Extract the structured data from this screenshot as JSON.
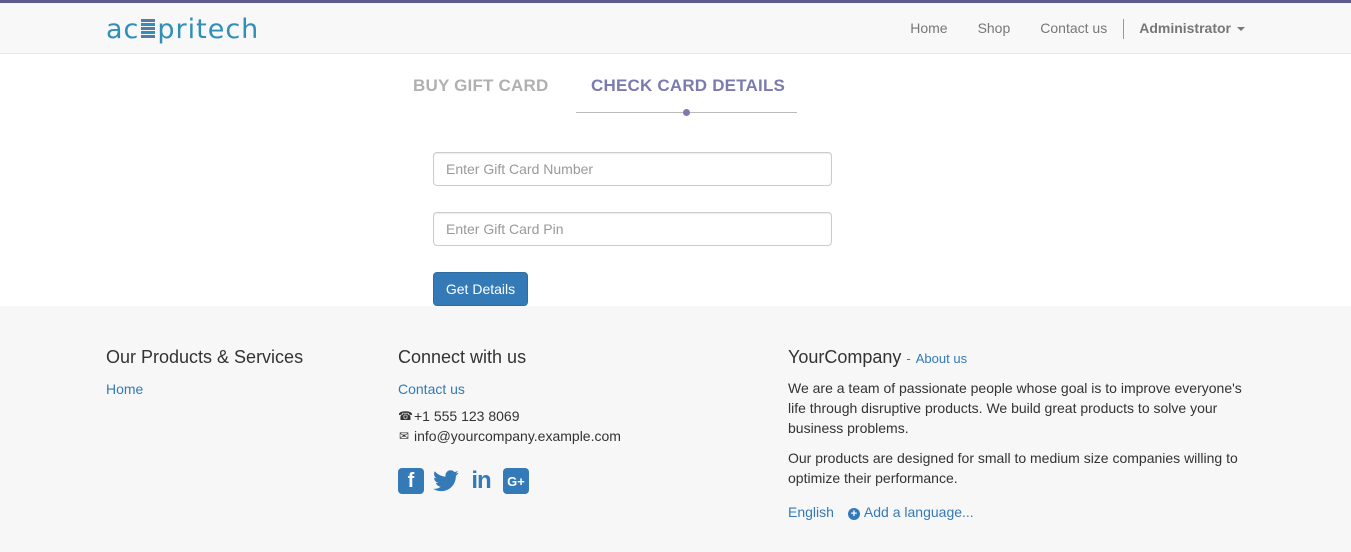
{
  "brand": {
    "logo_left": "ac",
    "logo_right": "pritech",
    "color": "#2f8fb8"
  },
  "nav": {
    "items": [
      {
        "label": "Home"
      },
      {
        "label": "Shop"
      },
      {
        "label": "Contact us"
      }
    ],
    "user": "Administrator"
  },
  "tabs": {
    "buy": "BUY GIFT CARD",
    "check": "CHECK CARD DETAILS",
    "active": "check"
  },
  "form": {
    "card_number_placeholder": "Enter Gift Card Number",
    "card_pin_placeholder": "Enter Gift Card Pin",
    "submit_label": "Get Details"
  },
  "footer": {
    "products": {
      "title": "Our Products & Services",
      "links": [
        "Home"
      ]
    },
    "connect": {
      "title": "Connect with us",
      "contact_link": "Contact us",
      "phone": "+1 555 123 8069",
      "email": "info@yourcompany.example.com",
      "socials": [
        "facebook-icon",
        "twitter-icon",
        "linkedin-icon",
        "google-plus-icon"
      ]
    },
    "about": {
      "company": "YourCompany",
      "about_link": "About us",
      "para1": "We are a team of passionate people whose goal is to improve everyone's life through disruptive products. We build great products to solve your business problems.",
      "para2": "Our products are designed for small to medium size companies willing to optimize their performance.",
      "language": "English",
      "add_language": "Add a language..."
    }
  },
  "colors": {
    "accent": "#7c7bad",
    "primary": "#337ab7",
    "topline": "#5f5b8f"
  }
}
